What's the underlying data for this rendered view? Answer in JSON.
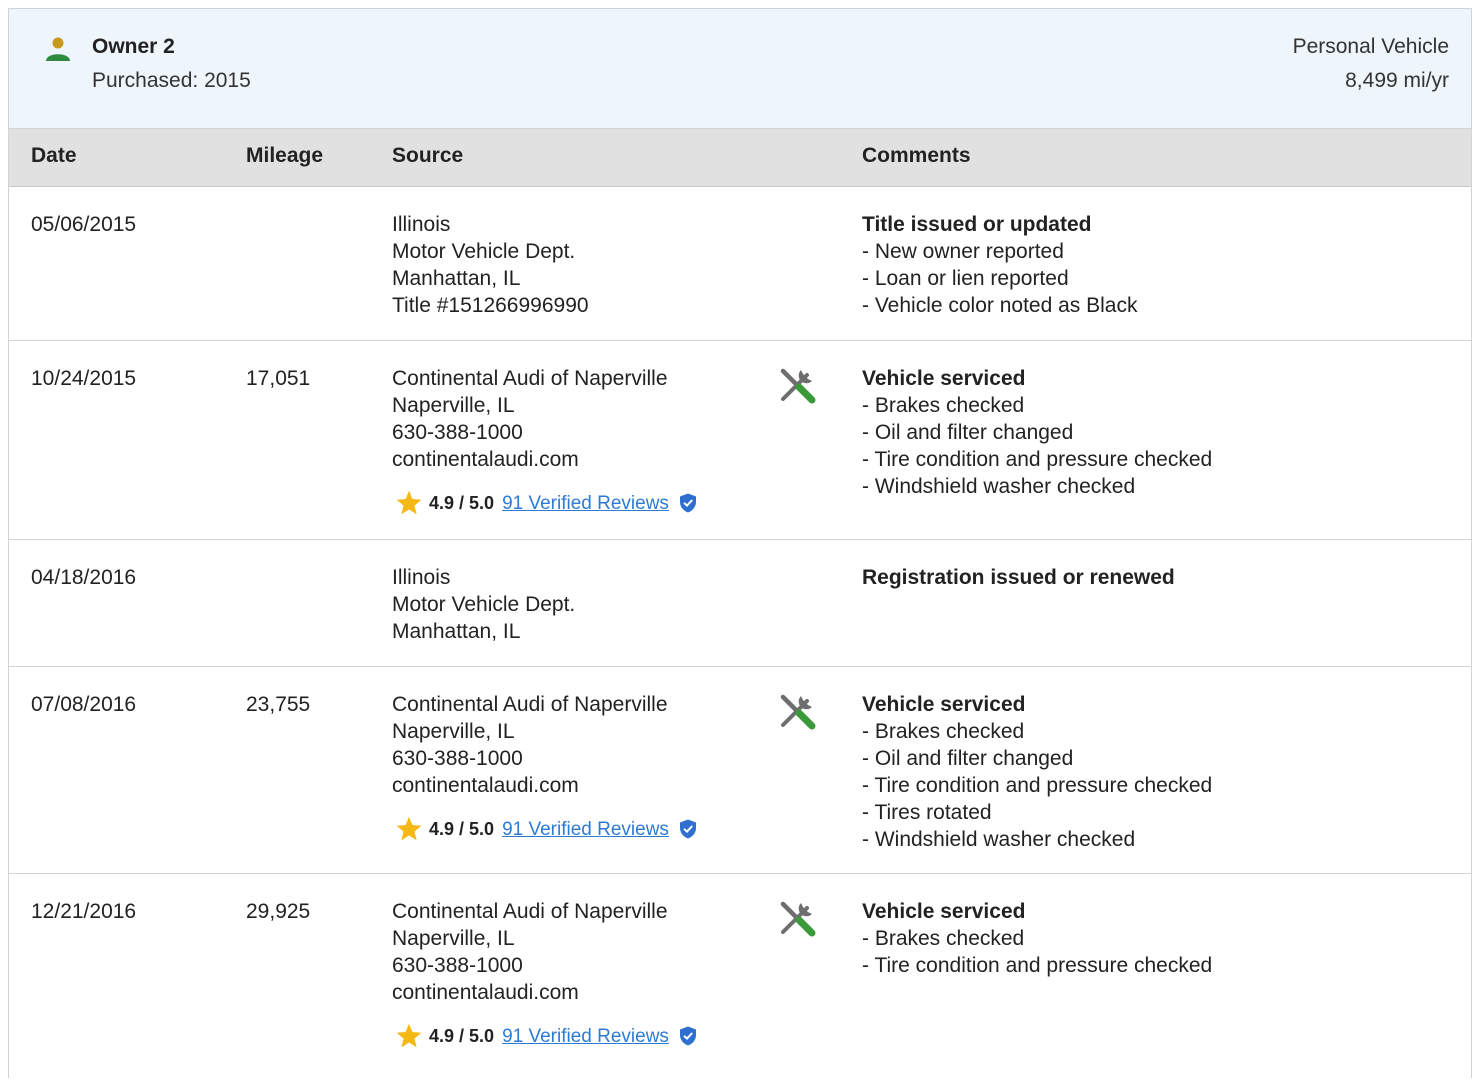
{
  "owner": {
    "title": "Owner 2",
    "purchased": "Purchased: 2015",
    "type": "Personal Vehicle",
    "miles_per_year": "8,499 mi/yr"
  },
  "table": {
    "headers": {
      "date": "Date",
      "mileage": "Mileage",
      "source": "Source",
      "comments": "Comments"
    },
    "rows": [
      {
        "date": "05/06/2015",
        "mileage": "",
        "source": [
          "Illinois",
          "Motor Vehicle Dept.",
          "Manhattan, IL",
          "Title #151266996990"
        ],
        "comment_title": "Title issued or updated",
        "comments": [
          "- New owner reported",
          "- Loan or lien reported",
          "- Vehicle color noted as Black"
        ]
      },
      {
        "date": "10/24/2015",
        "mileage": "17,051",
        "source": [
          "Continental Audi of Naperville",
          "Naperville, IL",
          "630-388-1000",
          "continentalaudi.com"
        ],
        "rating": "4.9 / 5.0",
        "reviews": "91 Verified Reviews",
        "comment_title": "Vehicle serviced",
        "comments": [
          "- Brakes checked",
          "- Oil and filter changed",
          "- Tire condition and pressure checked",
          "- Windshield washer checked"
        ]
      },
      {
        "date": "04/18/2016",
        "mileage": "",
        "source": [
          "Illinois",
          "Motor Vehicle Dept.",
          "Manhattan, IL"
        ],
        "comment_title": "Registration issued or renewed",
        "comments": []
      },
      {
        "date": "07/08/2016",
        "mileage": "23,755",
        "source": [
          "Continental Audi of Naperville",
          "Naperville, IL",
          "630-388-1000",
          "continentalaudi.com"
        ],
        "rating": "4.9 / 5.0",
        "reviews": "91 Verified Reviews",
        "comment_title": "Vehicle serviced",
        "comments": [
          "- Brakes checked",
          "- Oil and filter changed",
          "- Tire condition and pressure checked",
          "- Tires rotated",
          "- Windshield washer checked"
        ]
      },
      {
        "date": "12/21/2016",
        "mileage": "29,925",
        "source": [
          "Continental Audi of Naperville",
          "Naperville, IL",
          "630-388-1000",
          "continentalaudi.com"
        ],
        "rating": "4.9 / 5.0",
        "reviews": "91 Verified Reviews",
        "comment_title": "Vehicle serviced",
        "comments": [
          "- Brakes checked",
          "- Tire condition and pressure checked"
        ]
      }
    ]
  },
  "icons": {
    "owner": "person-icon",
    "service": "tools-icon",
    "rating": "star-icon",
    "verified": "shield-check-icon"
  },
  "colors": {
    "person_head": "#c79a1e",
    "person_body": "#2e8b3e",
    "star": "#f5b915",
    "link": "#2e7bd6",
    "verified": "#2e6fd0",
    "wrench_handle": "#3a9a3a",
    "header_bg": "#eef5fb",
    "table_head_bg": "#e1e1e1"
  }
}
